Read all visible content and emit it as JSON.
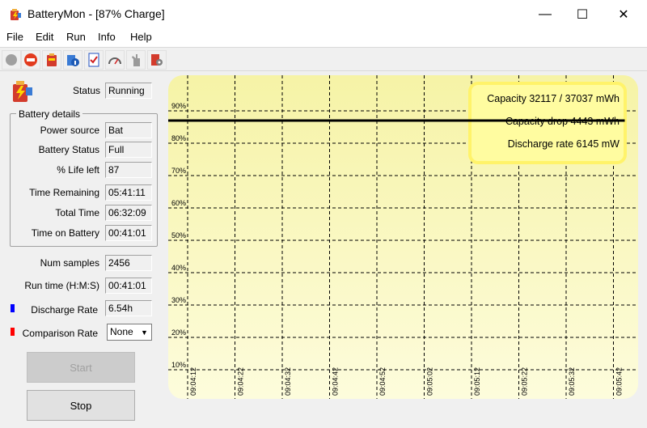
{
  "window": {
    "title": "BatteryMon - [87% Charge]",
    "minimize_glyph": "—",
    "maximize_glyph": "☐",
    "close_glyph": "✕"
  },
  "menu": [
    "File",
    "Edit",
    "Run",
    "Info",
    "Help"
  ],
  "toolbar_icons": [
    "record-icon",
    "stop-icon",
    "battery-icon",
    "battery-info-icon",
    "checklist-icon",
    "gauge-icon",
    "hand-icon",
    "settings-icon"
  ],
  "status": {
    "label": "Status",
    "value": "Running"
  },
  "battery_details": {
    "title": "Battery details",
    "power_source": {
      "label": "Power source",
      "value": "Bat"
    },
    "battery_status": {
      "label": "Battery Status",
      "value": "Full"
    },
    "life_left": {
      "label": "% Life left",
      "value": "87"
    },
    "time_remaining": {
      "label": "Time Remaining",
      "value": "05:41:11"
    },
    "total_time": {
      "label": "Total Time",
      "value": "06:32:09"
    },
    "time_on_battery": {
      "label": "Time on Battery",
      "value": "00:41:01"
    }
  },
  "num_samples": {
    "label": "Num samples",
    "value": "2456"
  },
  "run_time": {
    "label": "Run time (H:M:S)",
    "value": "00:41:01"
  },
  "discharge_rate": {
    "label": "Discharge Rate",
    "value": "6.54h",
    "color": "#0000ff"
  },
  "comparison_rate": {
    "label": "Comparison Rate",
    "value": "None",
    "color": "#ff0000"
  },
  "buttons": {
    "start": "Start",
    "stop": "Stop"
  },
  "chart_data": {
    "type": "line",
    "y_tick_labels": [
      "90%",
      "80%",
      "70%",
      "60%",
      "50%",
      "40%",
      "30%",
      "20%",
      "10%"
    ],
    "x_tick_labels": [
      "09:04:12",
      "09:04:22",
      "09:04:32",
      "09:04:42",
      "09:04:52",
      "09:05:02",
      "09:05:12",
      "09:05:22",
      "09:05:32",
      "09:05:42"
    ],
    "ylim": [
      10,
      90
    ],
    "grid": true,
    "series": [
      {
        "color": "#000000",
        "x": [
          "09:04:12",
          "09:05:42"
        ],
        "values": [
          87,
          87
        ]
      }
    ],
    "info_box": {
      "capacity": "Capacity 32117 / 37037 mWh",
      "capacity_drop": "Capacity drop 4443 mWh",
      "discharge_rate": "Discharge rate 6145 mW"
    }
  }
}
